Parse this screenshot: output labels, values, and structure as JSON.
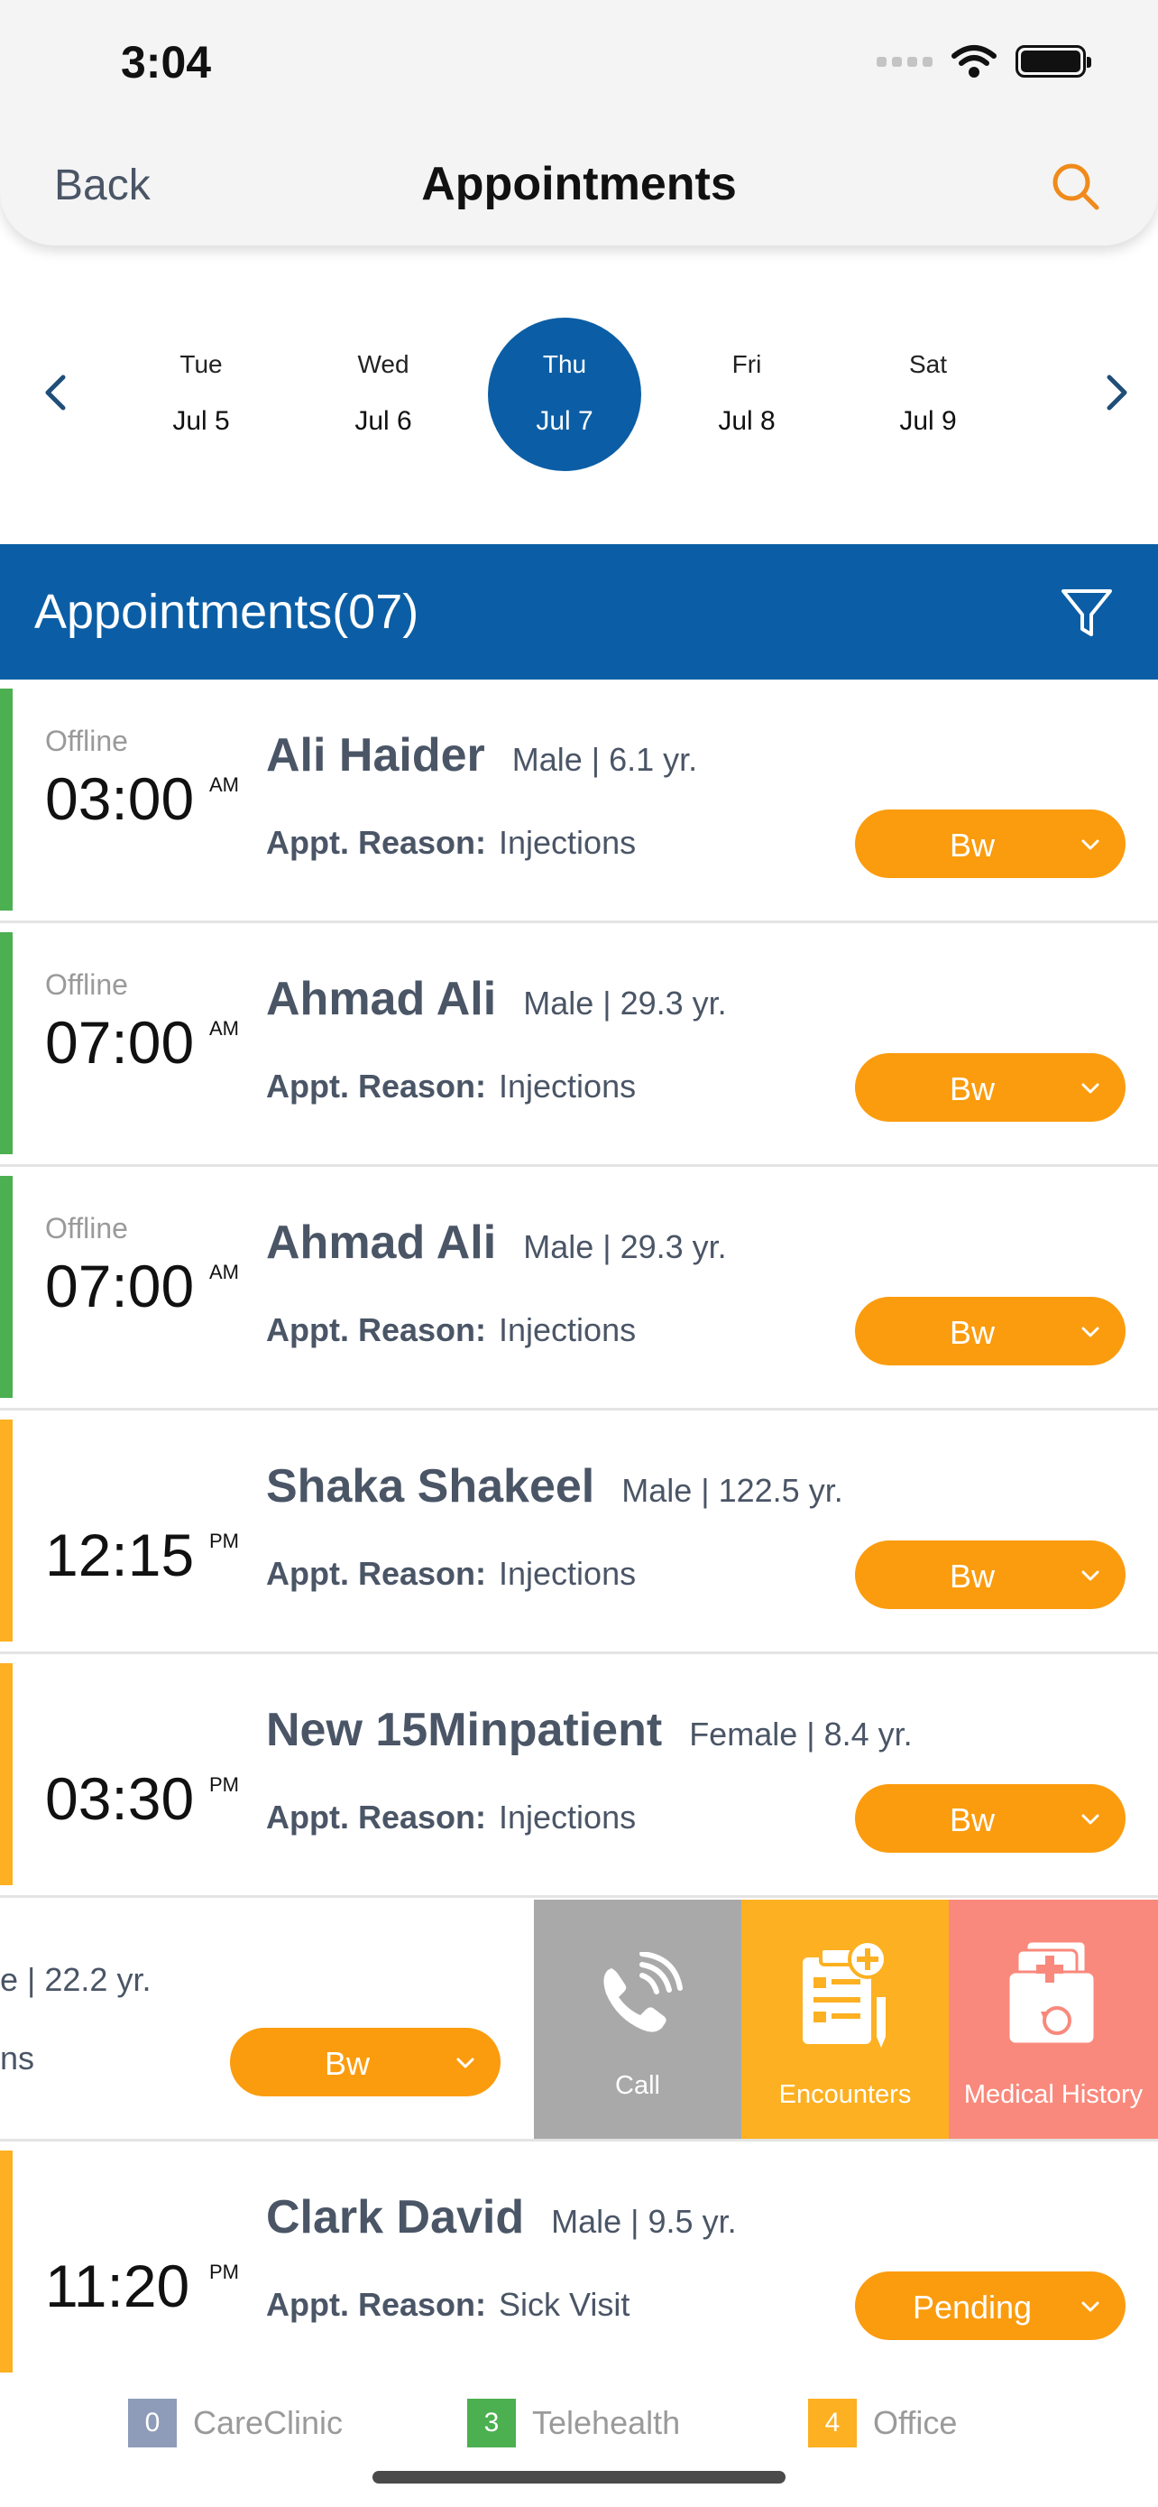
{
  "status_bar": {
    "time": "3:04"
  },
  "nav": {
    "back_label": "Back",
    "title": "Appointments"
  },
  "date_strip": {
    "days": [
      {
        "dow": "Tue",
        "date": "Jul 5"
      },
      {
        "dow": "Wed",
        "date": "Jul 6"
      },
      {
        "dow": "Thu",
        "date": "Jul 7",
        "selected": true
      },
      {
        "dow": "Fri",
        "date": "Jul 8"
      },
      {
        "dow": "Sat",
        "date": "Jul 9"
      }
    ]
  },
  "section": {
    "title": "Appointments(07)"
  },
  "colors": {
    "primary": "#0b5ea5",
    "orange": "#fb9c0e",
    "telehealth_green": "#4caf50",
    "office_orange": "#fdb021",
    "careclinic_gray": "#8e9cba",
    "call_gray": "#a9a9a9",
    "encounters_yellow": "#fdb021",
    "medical_history_red": "#f9897c"
  },
  "appointments": [
    {
      "mode": "Offline",
      "time": "03:00",
      "ampm": "AM",
      "name": "Ali Haider",
      "demographics": "Male | 6.1 yr.",
      "reason_label": "Appt. Reason:",
      "reason": "Injections",
      "status": "Bw",
      "type": "telehealth"
    },
    {
      "mode": "Offline",
      "time": "07:00",
      "ampm": "AM",
      "name": "Ahmad Ali",
      "demographics": "Male | 29.3 yr.",
      "reason_label": "Appt. Reason:",
      "reason": "Injections",
      "status": "Bw",
      "type": "telehealth"
    },
    {
      "mode": "Offline",
      "time": "07:00",
      "ampm": "AM",
      "name": "Ahmad Ali",
      "demographics": "Male | 29.3 yr.",
      "reason_label": "Appt. Reason:",
      "reason": "Injections",
      "status": "Bw",
      "type": "telehealth"
    },
    {
      "mode": "",
      "time": "12:15",
      "ampm": "PM",
      "name": "Shaka Shakeel",
      "demographics": "Male | 122.5 yr.",
      "reason_label": "Appt. Reason:",
      "reason": "Injections",
      "status": "Bw",
      "type": "office"
    },
    {
      "mode": "",
      "time": "03:30",
      "ampm": "PM",
      "name": "New 15Minpatient",
      "demographics": "Female | 8.4 yr.",
      "reason_label": "Appt. Reason:",
      "reason": "Injections",
      "status": "Bw",
      "type": "office"
    }
  ],
  "swiped_row": {
    "demographics_visible": "e | 22.2 yr.",
    "reason_visible": "ns",
    "status": "Bw",
    "actions": {
      "call": "Call",
      "encounters": "Encounters",
      "medical_history": "Medical History"
    }
  },
  "last_appointment": {
    "mode": "",
    "time": "11:20",
    "ampm": "PM",
    "name": "Clark David",
    "demographics": "Male | 9.5 yr.",
    "reason_label": "Appt. Reason:",
    "reason": "Sick Visit",
    "status": "Pending",
    "type": "office"
  },
  "legend": [
    {
      "count": "0",
      "label": "CareClinic"
    },
    {
      "count": "3",
      "label": "Telehealth"
    },
    {
      "count": "4",
      "label": "Office"
    }
  ]
}
